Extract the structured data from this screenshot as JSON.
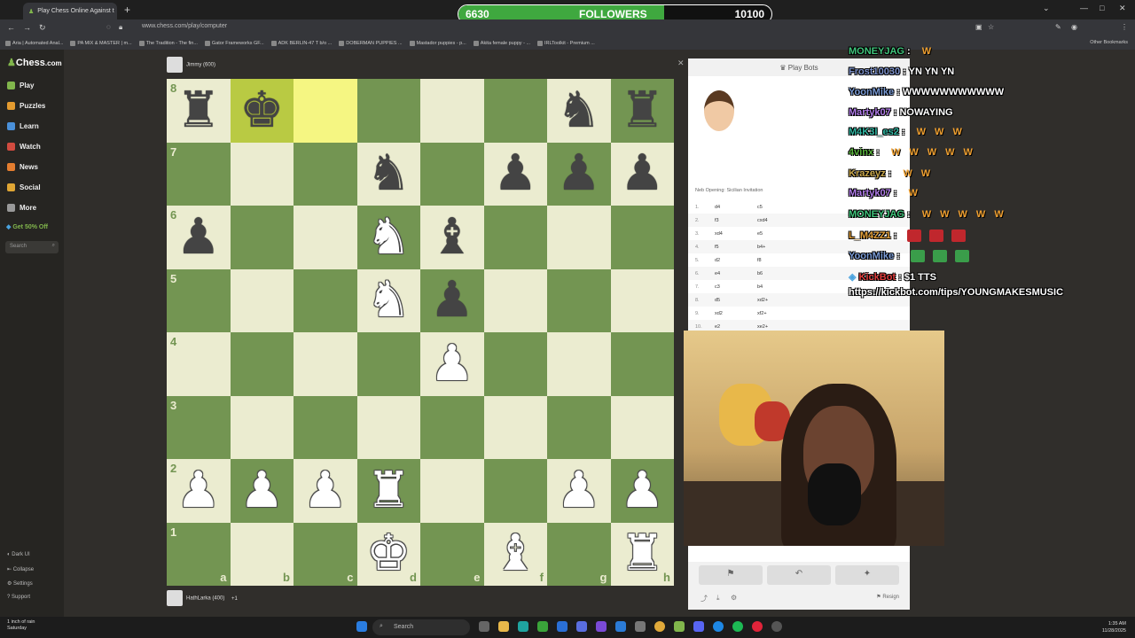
{
  "browser": {
    "tab_title": "Play Chess Online Against t",
    "url": "www.chess.com/play/computer",
    "other_bookmarks": "Other Bookmarks",
    "bookmarks": [
      "Aria | Automated Anal...",
      "PA MIX & MASTER | m...",
      "The Tradition - The fin...",
      "Gator Frameworks GF...",
      "ADK BERLIN-47 T b/o ...",
      "DOBERMAN PUPPIES ...",
      "Mastador puppies - p...",
      "Akita female puppy - ...",
      "IRLToolkit - Premium ..."
    ]
  },
  "followers": {
    "current": "6630",
    "label": "FOLLOWERS",
    "goal": "10100",
    "progress": 0.6565
  },
  "sidebar": {
    "logo": "Chess",
    "logo_suffix": ".com",
    "items": [
      {
        "label": "Play",
        "color": "#81b64c"
      },
      {
        "label": "Puzzles",
        "color": "#e49b2f"
      },
      {
        "label": "Learn",
        "color": "#4a90d9"
      },
      {
        "label": "Watch",
        "color": "#d14b3f"
      },
      {
        "label": "News",
        "color": "#e47d2f"
      },
      {
        "label": "Social",
        "color": "#e0a634"
      },
      {
        "label": "More",
        "color": "#999999"
      }
    ],
    "promo": "Get 50% Off",
    "search_placeholder": "Search",
    "footer": [
      "Dark UI",
      "Collapse",
      "Settings",
      "Support"
    ]
  },
  "game": {
    "top_player": "Jimmy (600)",
    "bottom_player": "HathLarka (400)",
    "bottom_extra": "+1",
    "ranks": [
      "8",
      "7",
      "6",
      "5",
      "4",
      "3",
      "2",
      "1"
    ],
    "files": [
      "a",
      "b",
      "c",
      "d",
      "e",
      "f",
      "g",
      "h"
    ],
    "highlight_squares": [
      "b8",
      "c8"
    ],
    "pieces": [
      {
        "sq": "a8",
        "glyph": "♜",
        "color": "black"
      },
      {
        "sq": "b8",
        "glyph": "♚",
        "color": "black"
      },
      {
        "sq": "g8",
        "glyph": "♞",
        "color": "black"
      },
      {
        "sq": "h8",
        "glyph": "♜",
        "color": "black"
      },
      {
        "sq": "d7",
        "glyph": "♞",
        "color": "black"
      },
      {
        "sq": "f7",
        "glyph": "♟",
        "color": "black"
      },
      {
        "sq": "g7",
        "glyph": "♟",
        "color": "black"
      },
      {
        "sq": "h7",
        "glyph": "♟",
        "color": "black"
      },
      {
        "sq": "a6",
        "glyph": "♟",
        "color": "black"
      },
      {
        "sq": "d6",
        "glyph": "♞",
        "color": "white"
      },
      {
        "sq": "e6",
        "glyph": "♝",
        "color": "black"
      },
      {
        "sq": "d5",
        "glyph": "♞",
        "color": "white"
      },
      {
        "sq": "e5",
        "glyph": "♟",
        "color": "black"
      },
      {
        "sq": "e4",
        "glyph": "♟",
        "color": "white"
      },
      {
        "sq": "a2",
        "glyph": "♟",
        "color": "white"
      },
      {
        "sq": "b2",
        "glyph": "♟",
        "color": "white"
      },
      {
        "sq": "c2",
        "glyph": "♟",
        "color": "white"
      },
      {
        "sq": "d2",
        "glyph": "♜",
        "color": "white"
      },
      {
        "sq": "g2",
        "glyph": "♟",
        "color": "white"
      },
      {
        "sq": "h2",
        "glyph": "♟",
        "color": "white"
      },
      {
        "sq": "d1",
        "glyph": "♚",
        "color": "white"
      },
      {
        "sq": "f1",
        "glyph": "♝",
        "color": "white"
      },
      {
        "sq": "h1",
        "glyph": "♜",
        "color": "white"
      }
    ]
  },
  "panel": {
    "title": "Play Bots",
    "opening": "Neb Opening: Sicilian Invitation",
    "moves": [
      {
        "n": "1.",
        "w": "d4",
        "b": "c5"
      },
      {
        "n": "2.",
        "w": "f3",
        "b": "cxd4"
      },
      {
        "n": "3.",
        "w": "xd4",
        "b": "e5"
      },
      {
        "n": "4.",
        "w": "f5",
        "b": "b4+"
      },
      {
        "n": "5.",
        "w": "d2",
        "b": "f8"
      },
      {
        "n": "6.",
        "w": "e4",
        "b": "b6"
      },
      {
        "n": "7.",
        "w": "c3",
        "b": "b4"
      },
      {
        "n": "8.",
        "w": "d5",
        "b": "xd2+"
      },
      {
        "n": "9.",
        "w": "xd2",
        "b": "xf2+"
      },
      {
        "n": "10.",
        "w": "e2",
        "b": "xe2+"
      }
    ],
    "resign": "Resign"
  },
  "chat": [
    {
      "user": "MONEYJAG",
      "color": "#3fc47b",
      "text": "",
      "w": 1
    },
    {
      "user": "Frost10030",
      "color": "#7a8fc9",
      "text": "YN  YN  YN",
      "w": 0
    },
    {
      "user": "YoonMike",
      "color": "#7a9bd6",
      "text": "WWWWWWWWWWW",
      "w": 0
    },
    {
      "user": "Martyk07",
      "color": "#b07be8",
      "text": "NOWAYING",
      "w": 0
    },
    {
      "user": "M4K3I_es2",
      "color": "#2fb5a1",
      "text": "",
      "w": 3
    },
    {
      "user": "4vinx",
      "color": "#59b33c",
      "text": "",
      "w": 5
    },
    {
      "user": "Krazeyz",
      "color": "#c9a74a",
      "text": "",
      "w": 2
    },
    {
      "user": "Martyk07",
      "color": "#b07be8",
      "text": "",
      "w": 1
    },
    {
      "user": "MONEYJAG",
      "color": "#3fc47b",
      "text": "",
      "w": 5
    },
    {
      "user": "L_M4ZZ1",
      "color": "#e6a23c",
      "text": "",
      "w": 0,
      "emotes": "#c0272d"
    },
    {
      "user": "YoonMike",
      "color": "#7a9bd6",
      "text": "",
      "w": 0,
      "emotes": "#3a9d4a"
    },
    {
      "user": "KickBot",
      "color": "#e03c3c",
      "text": "$1 TTS",
      "w": 0
    }
  ],
  "chat_link": "https://kickbot.com/tips/YOUNGMAKESMUSIC",
  "taskbar": {
    "weather_line1": "1 inch of rain",
    "weather_line2": "Saturday",
    "search": "Search",
    "time": "1:35 AM",
    "date": "11/28/2025"
  }
}
